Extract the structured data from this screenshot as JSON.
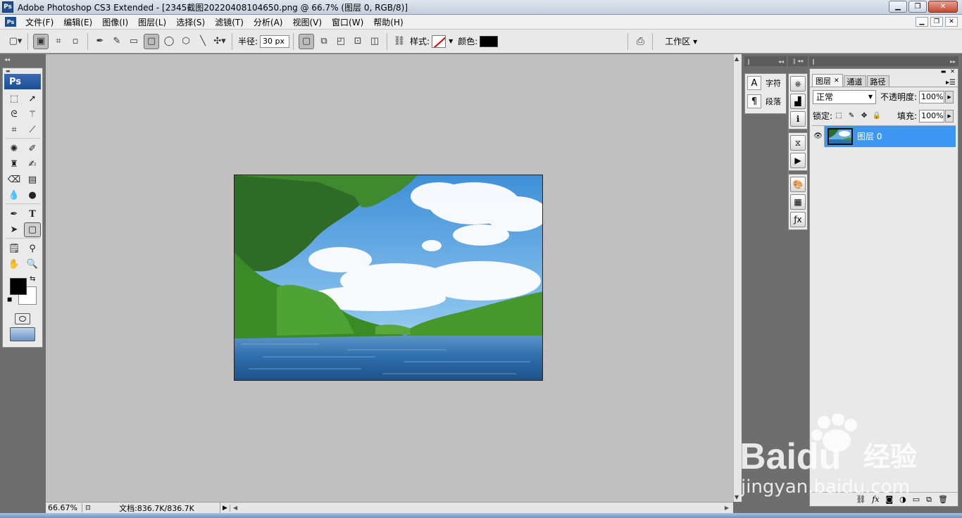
{
  "window": {
    "title": "Adobe Photoshop CS3 Extended - [2345截图20220408104650.png @ 66.7% (图层 0, RGB/8)]",
    "app_badge": "Ps",
    "controls": [
      "minimize-icon",
      "maximize-icon",
      "close-icon"
    ]
  },
  "menubar": {
    "items": [
      "文件(F)",
      "编辑(E)",
      "图像(I)",
      "图层(L)",
      "选择(S)",
      "滤镜(T)",
      "分析(A)",
      "视图(V)",
      "窗口(W)",
      "帮助(H)"
    ]
  },
  "options_bar": {
    "radius_label": "半径:",
    "radius_value": "30 px",
    "style_label": "样式:",
    "color_label": "颜色:",
    "color_value": "#000000",
    "workspace_label": "工作区"
  },
  "toolbox": {
    "header": "Ps",
    "foreground_color": "#000000",
    "background_color": "#ffffff",
    "active_tool": "rounded-rectangle-tool"
  },
  "status_bar": {
    "zoom": "66.67%",
    "doc_size": "文档:836.7K/836.7K"
  },
  "character_panel": {
    "items": [
      {
        "icon": "A",
        "label": "字符"
      },
      {
        "icon": "¶",
        "label": "段落"
      }
    ]
  },
  "layers_panel": {
    "tabs": [
      "图层",
      "通道",
      "路径"
    ],
    "active_tab": "图层",
    "blend_mode": "正常",
    "opacity_label": "不透明度:",
    "opacity_value": "100%",
    "lock_label": "锁定:",
    "fill_label": "填充:",
    "fill_value": "100%",
    "layers": [
      {
        "name": "图层 0",
        "visible": true,
        "selected": true
      }
    ]
  },
  "watermark": {
    "brand": "Baidu",
    "cn": "经验",
    "url": "jingyan.baidu.com"
  },
  "colors": {
    "selection": "#3d96f2",
    "canvas_bg": "#c0c0c0",
    "ps_blue": "#1c4f94"
  }
}
